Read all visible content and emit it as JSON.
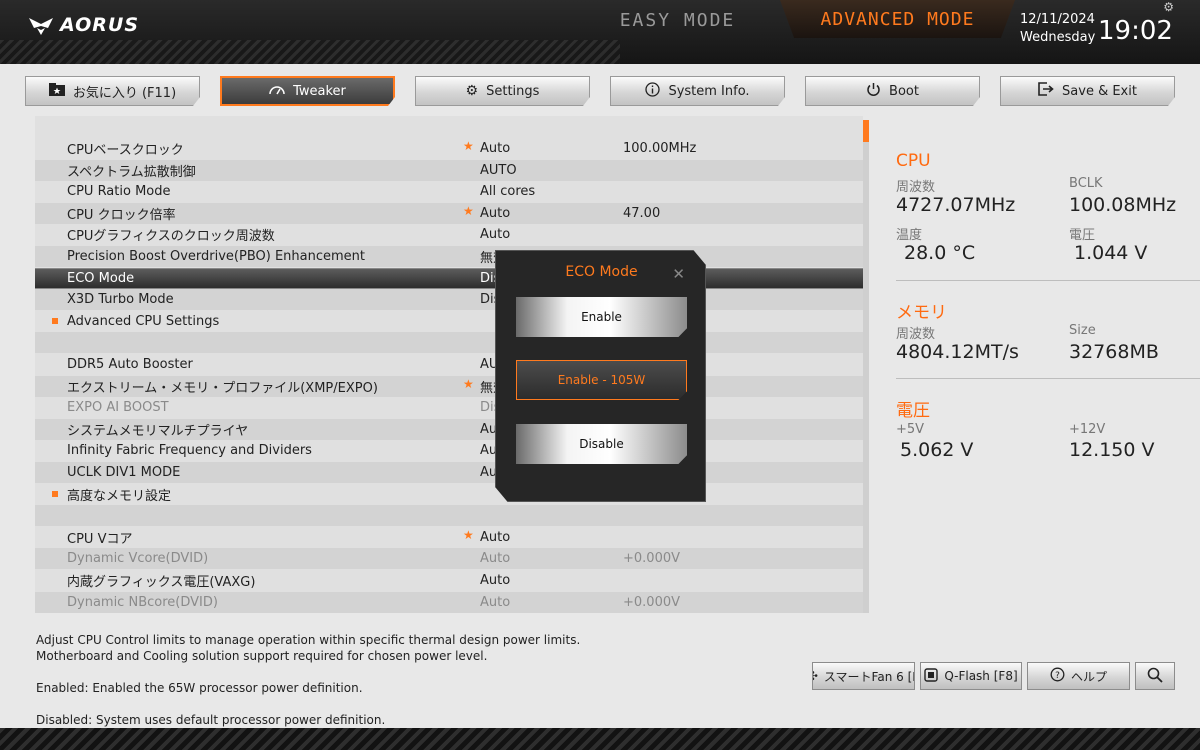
{
  "header": {
    "logo_text": "AORUS",
    "easy_mode_label": "EASY MODE",
    "advanced_mode_label": "ADVANCED MODE",
    "date": "12/11/2024",
    "day": "Wednesday",
    "time": "19:02"
  },
  "tabs": [
    {
      "label": "お気に入り (F11)",
      "icon": "star-folder-icon",
      "active": false
    },
    {
      "label": "Tweaker",
      "icon": "speedometer-icon",
      "active": true
    },
    {
      "label": "Settings",
      "icon": "gear-icon",
      "active": false
    },
    {
      "label": "System Info.",
      "icon": "info-icon",
      "active": false
    },
    {
      "label": "Boot",
      "icon": "power-icon",
      "active": false
    },
    {
      "label": "Save & Exit",
      "icon": "exit-icon",
      "active": false
    }
  ],
  "settings": [
    {
      "label": "CPUベースクロック",
      "value": "Auto",
      "value2": "100.00MHz",
      "star": true
    },
    {
      "label": "スペクトラム拡散制御",
      "value": "AUTO",
      "value2": ""
    },
    {
      "label": "CPU Ratio Mode",
      "value": "All cores",
      "value2": ""
    },
    {
      "label": "CPU クロック倍率",
      "value": "Auto",
      "value2": "47.00",
      "star": true
    },
    {
      "label": "CPUグラフィクスのクロック周波数",
      "value": "Auto",
      "value2": ""
    },
    {
      "label": "Precision Boost Overdrive(PBO) Enhancement",
      "value": "無効",
      "value2": ""
    },
    {
      "label": "ECO Mode",
      "value": "Disabled",
      "value2": "",
      "selected": true
    },
    {
      "label": "X3D Turbo Mode",
      "value": "Disabled",
      "value2": ""
    },
    {
      "label": "Advanced CPU Settings",
      "value": "",
      "value2": "",
      "submenu": true
    },
    {
      "label": "",
      "value": "",
      "value2": ""
    },
    {
      "label": "DDR5 Auto Booster",
      "value": "AUTO",
      "value2": ""
    },
    {
      "label": "エクストリーム・メモリ・プロファイル(XMP/EXPO)",
      "value": "無効",
      "value2": "",
      "star": true
    },
    {
      "label": "EXPO AI BOOST",
      "value": "Disabled",
      "value2": "",
      "dim": true
    },
    {
      "label": "システムメモリマルチプライヤ",
      "value": "Auto",
      "value2": ""
    },
    {
      "label": "Infinity Fabric Frequency and Dividers",
      "value": "Auto",
      "value2": ""
    },
    {
      "label": "UCLK DIV1 MODE",
      "value": "Auto",
      "value2": ""
    },
    {
      "label": "高度なメモリ設定",
      "value": "",
      "value2": "",
      "submenu": true
    },
    {
      "label": "",
      "value": "",
      "value2": ""
    },
    {
      "label": "CPU Vコア",
      "value": "Auto",
      "value2": "",
      "star": true
    },
    {
      "label": "Dynamic Vcore(DVID)",
      "value": "Auto",
      "value2": "+0.000V",
      "dim": true
    },
    {
      "label": "内蔵グラフィックス電圧(VAXG)",
      "value": "Auto",
      "value2": ""
    },
    {
      "label": "Dynamic NBcore(DVID)",
      "value": "Auto",
      "value2": "+0.000V",
      "dim": true
    }
  ],
  "info": {
    "cpu": {
      "title": "CPU",
      "freq_label": "周波数",
      "freq": "4727.07MHz",
      "bclk_label": "BCLK",
      "bclk": "100.08MHz",
      "temp_label": "温度",
      "temp": "28.0 °C",
      "volt_label": "電圧",
      "volt": "1.044 V"
    },
    "memory": {
      "title": "メモリ",
      "freq_label": "周波数",
      "freq": "4804.12MT/s",
      "size_label": "Size",
      "size": "32768MB"
    },
    "voltage": {
      "title": "電圧",
      "v5_label": "+5V",
      "v5": "5.062 V",
      "v12_label": "+12V",
      "v12": "12.150 V"
    }
  },
  "description": {
    "line1": "Adjust CPU Control limits to manage operation within specific thermal design power limits.",
    "line2": " Motherboard and Cooling solution support required for chosen power level.",
    "line3": "Enabled: Enabled the 65W processor power definition.",
    "line4": "Disabled: System uses default processor power definition."
  },
  "bottom_buttons": {
    "fan": "スマートFan 6 [F",
    "qflash": "Q-Flash [F8]",
    "help": "ヘルプ"
  },
  "modal": {
    "title": "ECO Mode",
    "options": [
      "Enable",
      "Enable - 105W",
      "Disable"
    ],
    "selected_index": 1
  },
  "colors": {
    "accent": "#ff7a1e"
  }
}
